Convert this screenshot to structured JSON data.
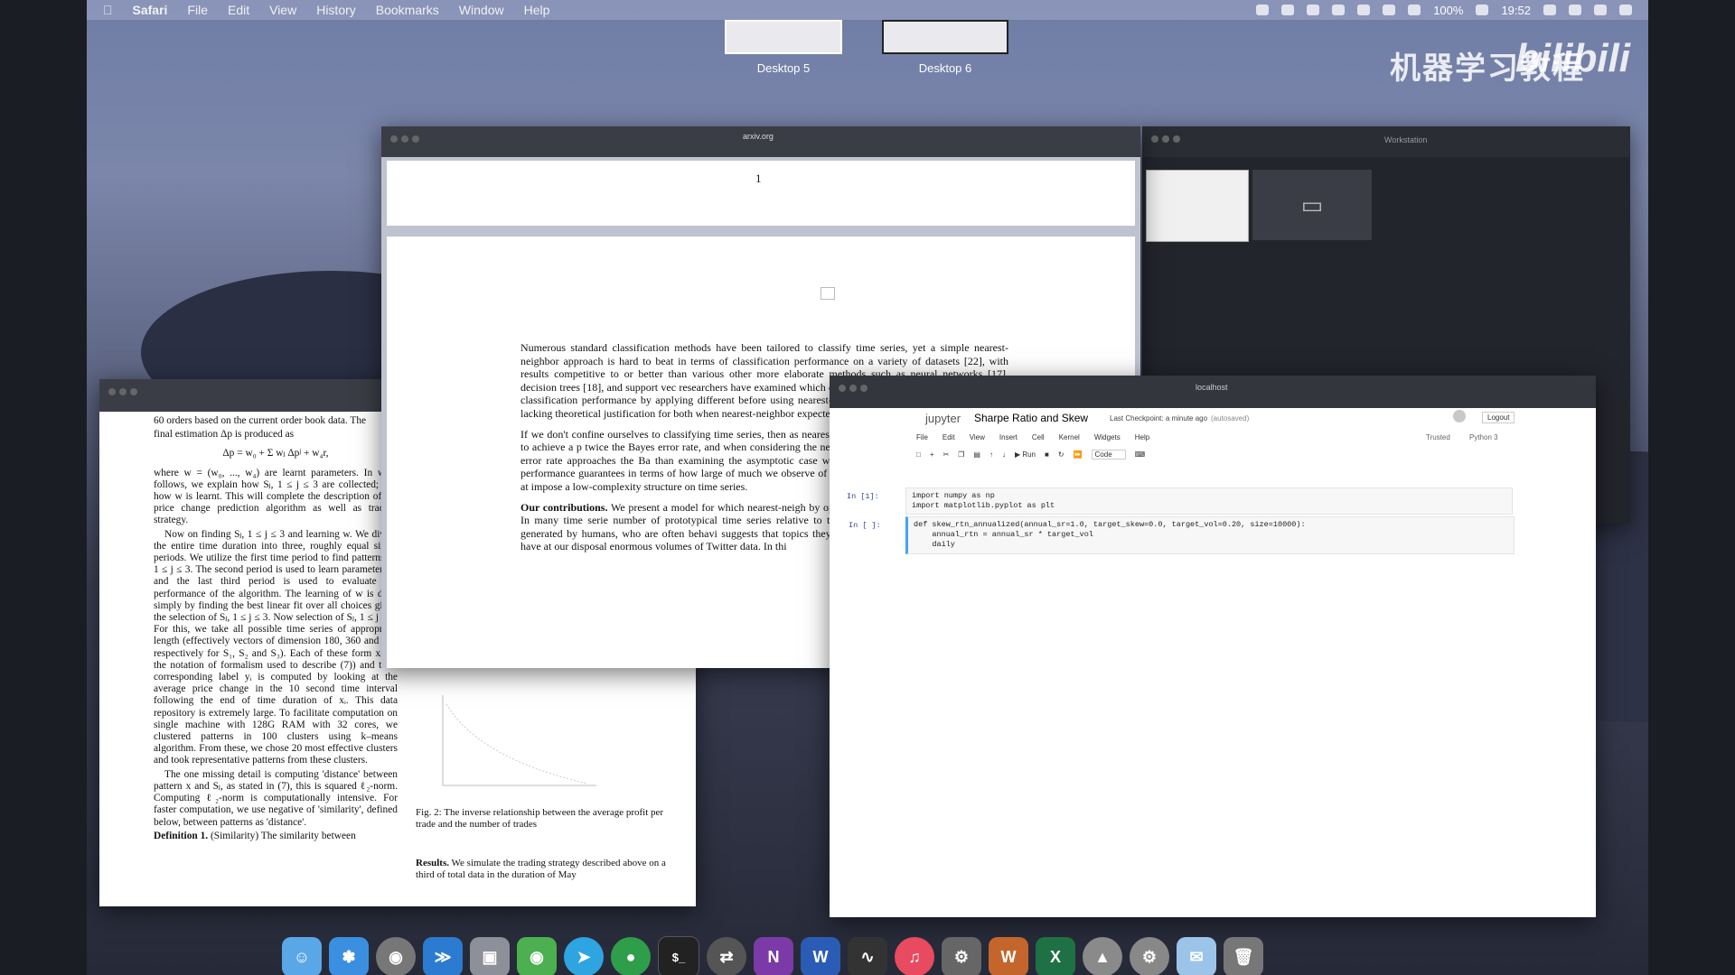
{
  "menubar": {
    "app_name": "Safari",
    "items": [
      "File",
      "Edit",
      "View",
      "History",
      "Bookmarks",
      "Window",
      "Help"
    ],
    "battery": "100%",
    "time": "19:52"
  },
  "spaces": [
    "Desktop 5",
    "Desktop 6"
  ],
  "watermark": {
    "text": "机器学习教程",
    "logo": "bilibili"
  },
  "arxiv_window": {
    "url": "arxiv.org",
    "page_number": "1",
    "paragraphs": [
      "Numerous standard classification methods have been tailored to classify time series, yet a simple nearest-neighbor approach is hard to beat in terms of classification performance on a variety of datasets [22], with results competitive to or better than various other more elaborate methods such as neural networks [17], decision trees [18], and support vec researchers have examined which distance to use with nearest how to boost classification performance by applying different before using nearest-neighbor classification [2]. These existi lacking theoretical justification for both when nearest-neighbor expected to perform well and how well.",
      "If we don't confine ourselves to classifying time series, then as nearest-neighbor classification has been shown to achieve a p twice the Bayes error rate, and when considering the nearest k with the amount of data, then the error rate approaches the Ba than examining the asymptotic case where the amount of data nonasymptotic performance guarantees in terms of how large of much we observe of the time series to be classified. To arrive at impose a low-complexity structure on time series."
    ],
    "contrib_label": "Our contributions.",
    "contrib_text": "We present a model for which nearest-neigh by operationalizing the following hypothesis: In many time serie number of prototypical time series relative to the number of tim posts on Twitter are generated by humans, who are often behavi suggests that topics they post about only become trends on Twi have at our disposal enormous volumes of Twitter data. In thi"
  },
  "left_paper": {
    "lines": [
      "60 orders based on the current order book data. The",
      "final estimation Δp is produced as"
    ],
    "equation": "Δp = w₀ + Σ wⱼ Δpʲ + w₄r,",
    "body": "where w = (w₀, ..., w₄) are learnt parameters. In what follows, we explain how Sⱼ, 1 ≤ j ≤ 3 are collected; and how w is learnt. This will complete the description of the price change prediction algorithm as well as trading strategy.",
    "body2": "Now on finding Sⱼ, 1 ≤ j ≤ 3 and learning w. We divide the entire time duration into three, roughly equal sized, periods. We utilize the first time period to find patterns Sⱼ, 1 ≤ j ≤ 3. The second period is used to learn parameters w and the last third period is used to evaluate the performance of the algorithm. The learning of w is done simply by finding the best linear fit over all choices given the selection of Sⱼ, 1 ≤ j ≤ 3. Now selection of Sⱼ, 1 ≤ j ≤ 3. For this, we take all possible time series of appropriate length (effectively vectors of dimension 180, 360 and 720 respectively for S₁, S₂ and S₃). Each of these form xᵢ (in the notation of formalism used to describe (7)) and their corresponding label yᵢ is computed by looking at the average price change in the 10 second time interval following the end of time duration of xᵢ. This data repository is extremely large. To facilitate computation on single machine with 128G RAM with 32 cores, we clustered patterns in 100 clusters using k–means algorithm. From these, we chose 20 most effective clusters and took representative patterns from these clusters.",
    "body3": "The one missing detail is computing 'distance' between pattern x and Sⱼ, as stated in (7), this is squared ℓ₂-norm. Computing ℓ₂-norm is computationally intensive. For faster computation, we use negative of 'similarity', defined below, between patterns as 'distance'.",
    "definition_label": "Definition 1.",
    "definition_text": "(Similarity) The similarity between",
    "fig_caption": "Fig. 2: The inverse relationship between the average profit per trade and the number of trades",
    "results_label": "Results.",
    "results_text": "We simulate the trading strategy described above on a third of total data in the duration of May"
  },
  "jupyter": {
    "window_title": "localhost",
    "logo": "jupyter",
    "notebook_title": "Sharpe Ratio and Skew",
    "checkpoint": "Last Checkpoint: a minute ago",
    "autosaved": "(autosaved)",
    "logout": "Logout",
    "menu": [
      "File",
      "Edit",
      "View",
      "Insert",
      "Cell",
      "Kernel",
      "Widgets",
      "Help"
    ],
    "trusted": "Trusted",
    "kernel": "Python 3",
    "run_label": "Run",
    "cell_type": "Code",
    "cells": [
      {
        "prompt": "In [1]:",
        "lines": [
          "import numpy as np",
          "import matplotlib.pyplot as plt"
        ]
      },
      {
        "prompt": "In [ ]:",
        "lines": [
          "def skew_rtn_annualized(annual_sr=1.0, target_skew=0.0, target_vol=0.20, size=10000):",
          "    annual_rtn = annual_sr * target_vol",
          "    daily"
        ]
      }
    ]
  },
  "side_window": {
    "tabs": [
      "",
      "Workstation"
    ]
  },
  "dock_icons": [
    "finder-icon",
    "safari-icon",
    "chrome-icon",
    "vscode-icon",
    "preview-icon",
    "wechat-icon",
    "telegram-icon",
    "evernote-icon",
    "terminal-icon",
    "remote-desktop-icon",
    "onenote-icon",
    "word-icon",
    "activity-monitor-icon",
    "music-icon",
    "system-icon",
    "writer-icon",
    "excel-icon",
    "launcher-icon",
    "settings-icon",
    "messages-icon",
    "trash-icon"
  ]
}
